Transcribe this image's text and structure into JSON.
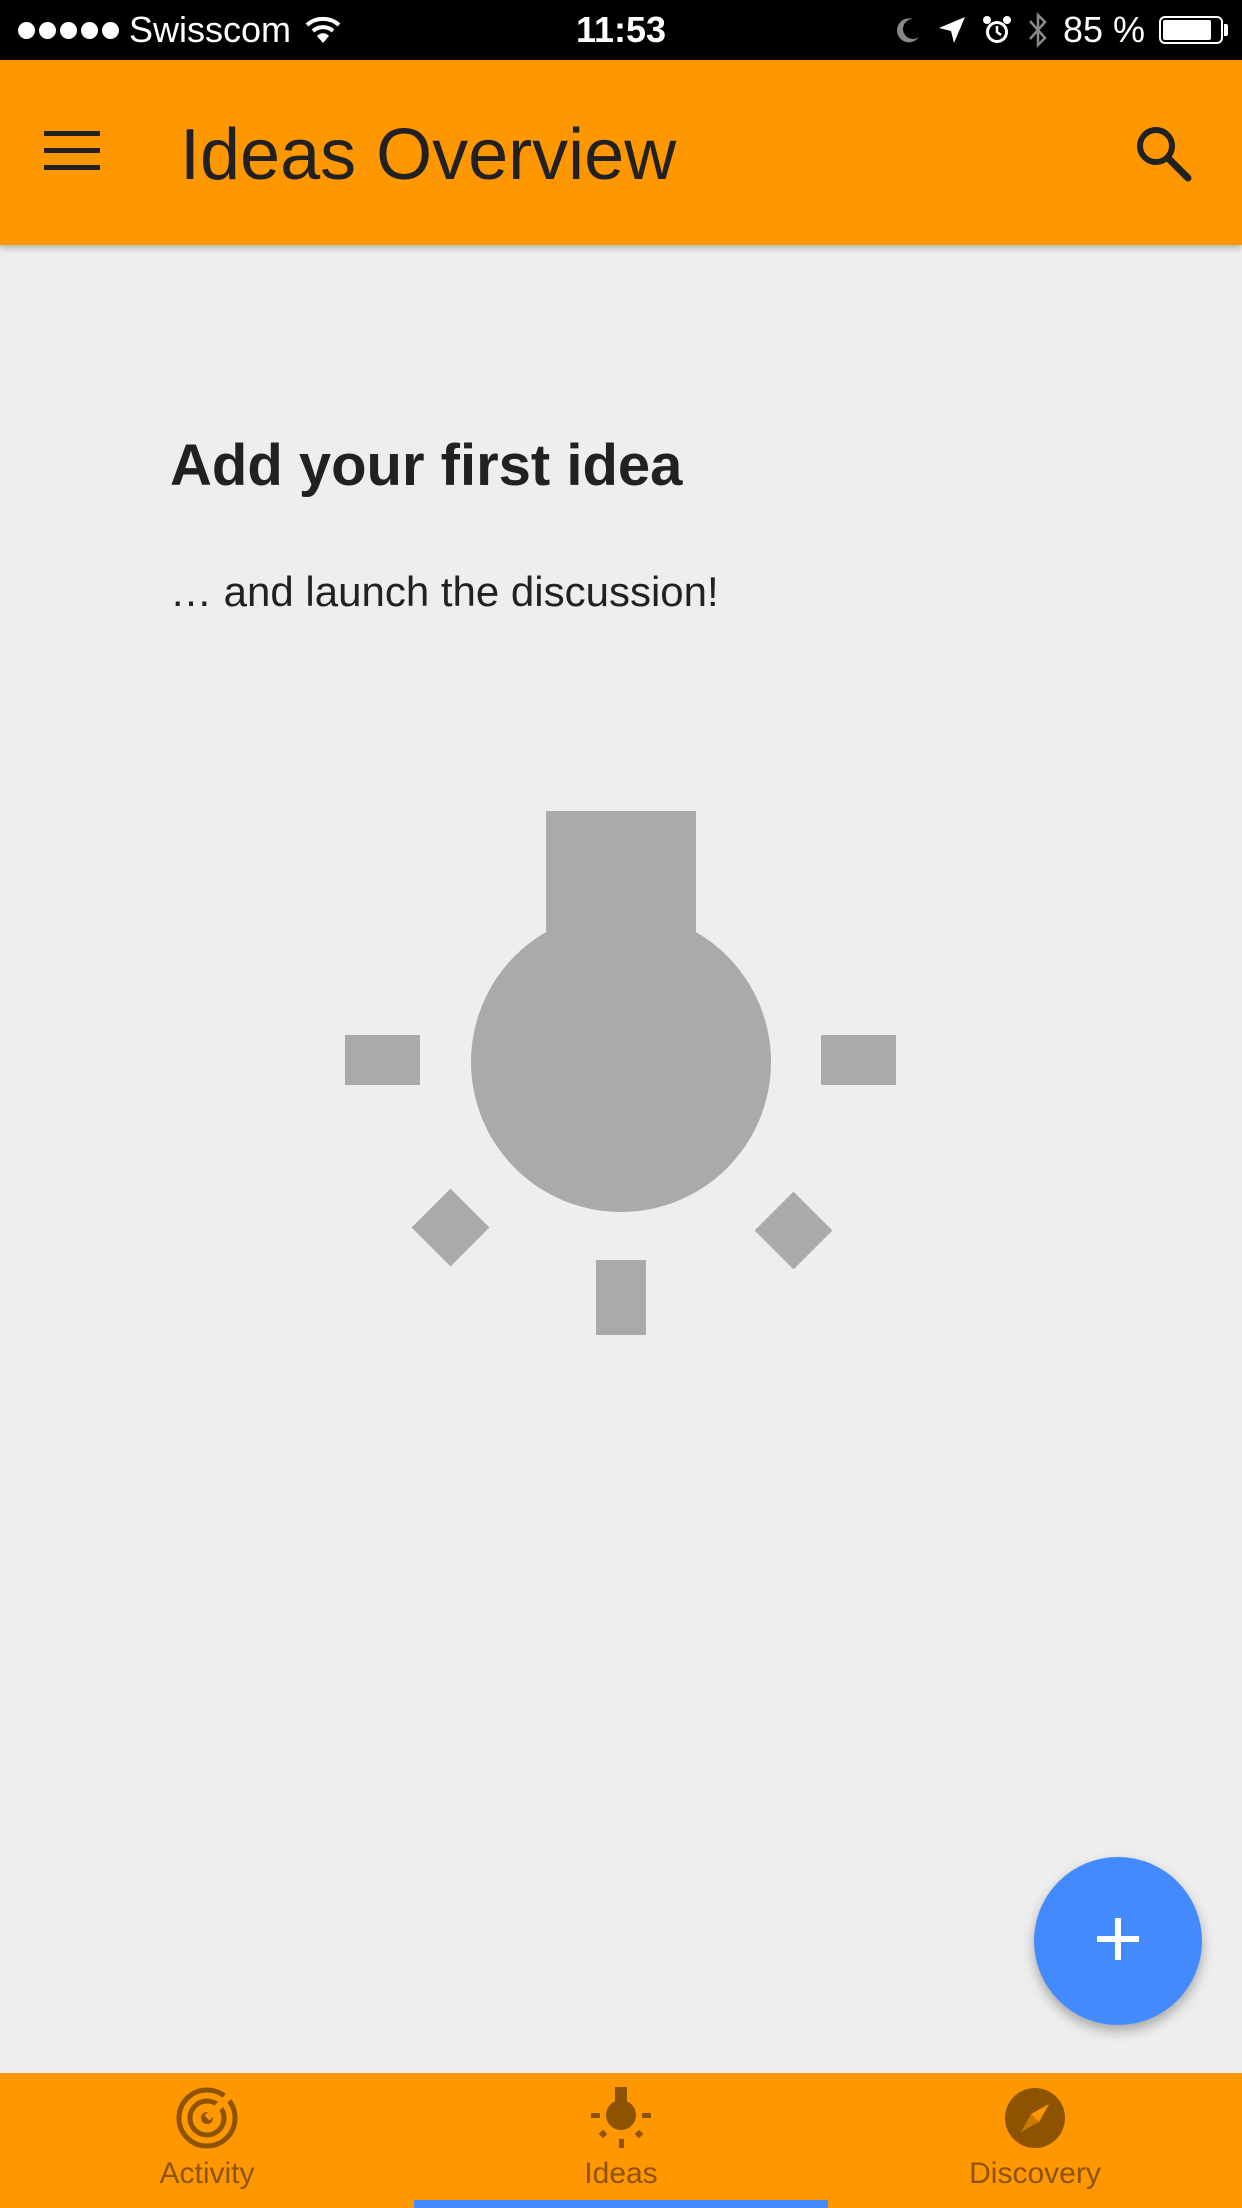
{
  "status_bar": {
    "carrier": "Swisscom",
    "time": "11:53",
    "battery_percent_label": "85 %",
    "battery_level": 0.85,
    "icons": [
      "signal-dots",
      "wifi-icon",
      "moon-icon",
      "location-arrow-icon",
      "alarm-icon",
      "bluetooth-icon",
      "battery-icon"
    ]
  },
  "app_bar": {
    "title": "Ideas Overview",
    "menu_icon": "hamburger-menu-icon",
    "search_icon": "search-icon"
  },
  "empty_state": {
    "title": "Add your first idea",
    "subtitle": "… and launch the discussion!",
    "illustration_icon": "lightbulb-icon"
  },
  "fab": {
    "icon": "plus-icon",
    "color": "#448aff"
  },
  "bottom_nav": {
    "tabs": [
      {
        "label": "Activity",
        "icon": "radar-icon",
        "selected": false
      },
      {
        "label": "Ideas",
        "icon": "lightbulb-icon",
        "selected": true
      },
      {
        "label": "Discovery",
        "icon": "compass-icon",
        "selected": false
      }
    ]
  },
  "colors": {
    "primary": "#ff9800",
    "background": "#eeeeee",
    "illustration": "#aaaaaa",
    "nav_inactive": "#8d5300",
    "accent": "#448aff"
  }
}
